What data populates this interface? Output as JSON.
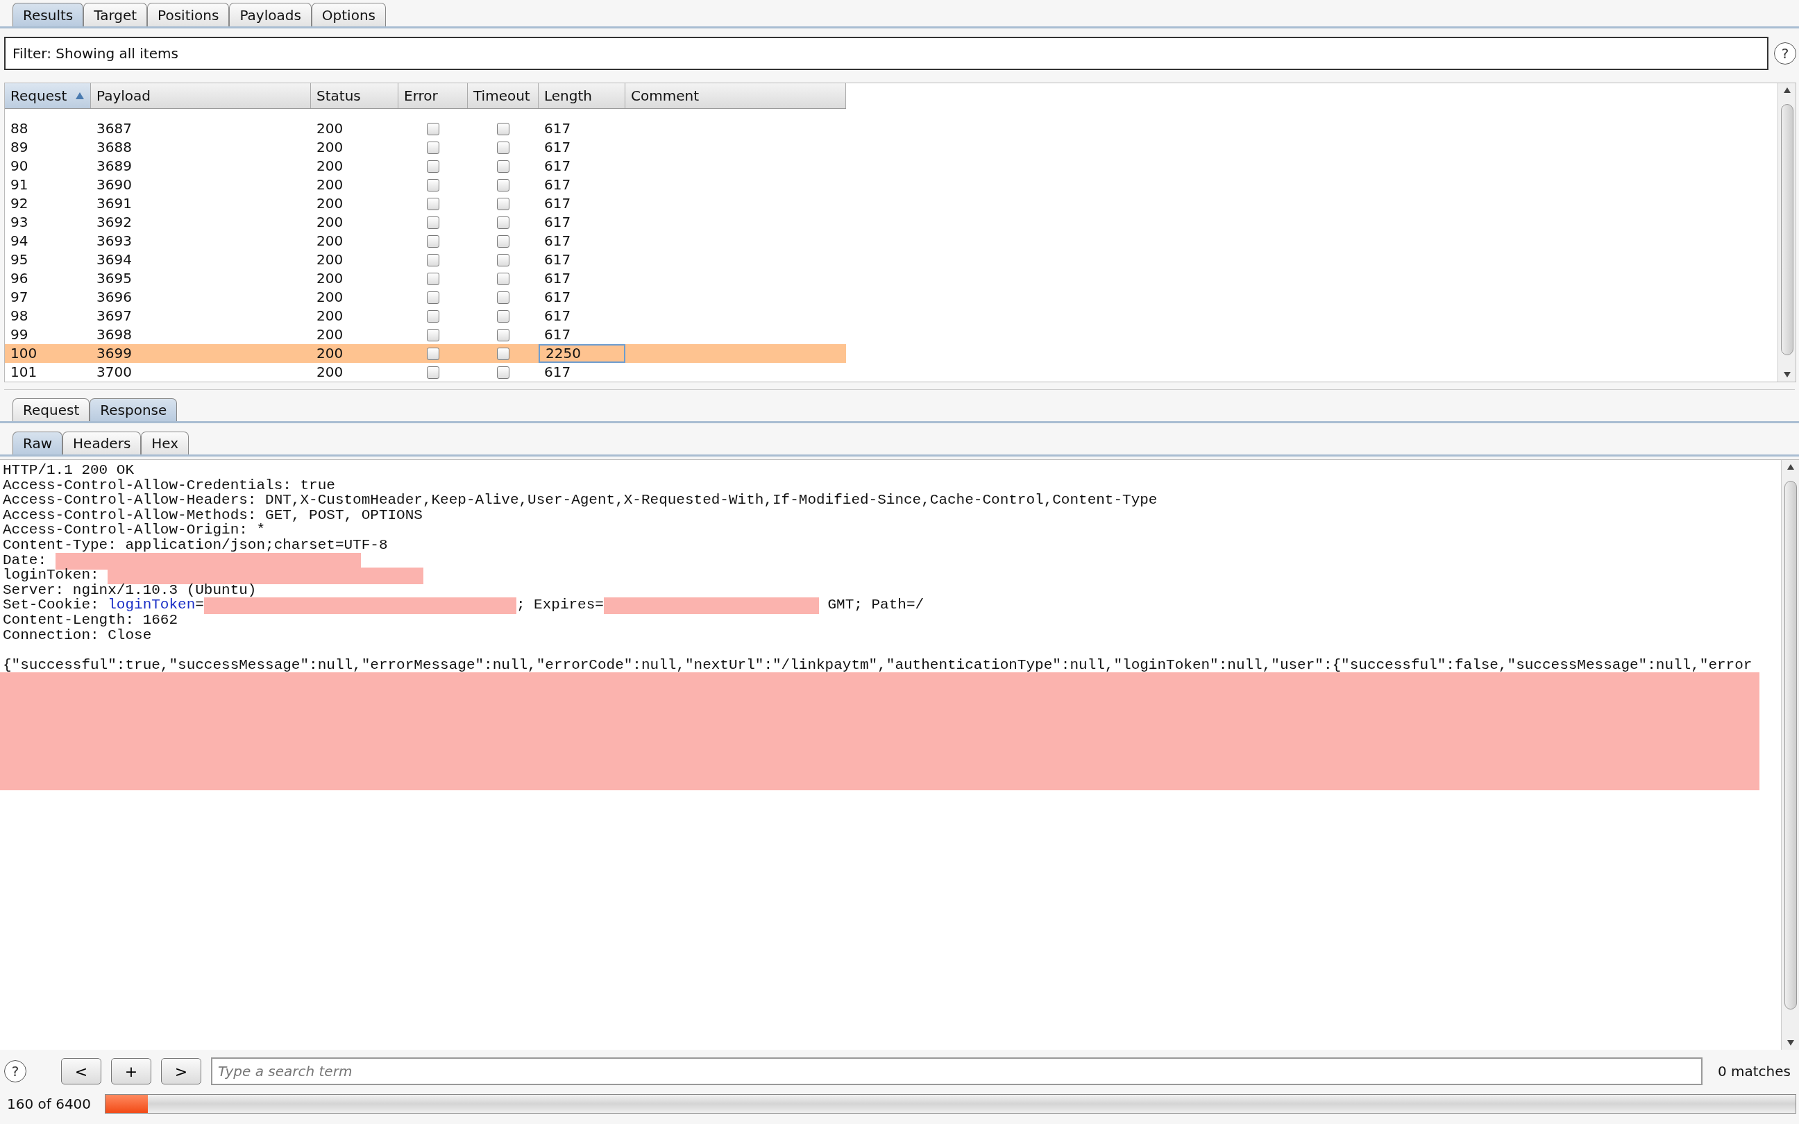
{
  "tabs": [
    {
      "label": "Results",
      "selected": true
    },
    {
      "label": "Target",
      "selected": false
    },
    {
      "label": "Positions",
      "selected": false
    },
    {
      "label": "Payloads",
      "selected": false
    },
    {
      "label": "Options",
      "selected": false
    }
  ],
  "filter": {
    "text": "Filter: Showing all items",
    "help": "?"
  },
  "table": {
    "columns": [
      {
        "label": "Request",
        "sorted": true
      },
      {
        "label": "Payload",
        "sorted": false
      },
      {
        "label": "Status",
        "sorted": false
      },
      {
        "label": "Error",
        "sorted": false
      },
      {
        "label": "Timeout",
        "sorted": false
      },
      {
        "label": "Length",
        "sorted": false
      },
      {
        "label": "Comment",
        "sorted": false
      }
    ],
    "rows": [
      {
        "request": "88",
        "payload": "3687",
        "status": "200",
        "error": false,
        "timeout": false,
        "length": "617",
        "selected": false
      },
      {
        "request": "89",
        "payload": "3688",
        "status": "200",
        "error": false,
        "timeout": false,
        "length": "617",
        "selected": false
      },
      {
        "request": "90",
        "payload": "3689",
        "status": "200",
        "error": false,
        "timeout": false,
        "length": "617",
        "selected": false
      },
      {
        "request": "91",
        "payload": "3690",
        "status": "200",
        "error": false,
        "timeout": false,
        "length": "617",
        "selected": false
      },
      {
        "request": "92",
        "payload": "3691",
        "status": "200",
        "error": false,
        "timeout": false,
        "length": "617",
        "selected": false
      },
      {
        "request": "93",
        "payload": "3692",
        "status": "200",
        "error": false,
        "timeout": false,
        "length": "617",
        "selected": false
      },
      {
        "request": "94",
        "payload": "3693",
        "status": "200",
        "error": false,
        "timeout": false,
        "length": "617",
        "selected": false
      },
      {
        "request": "95",
        "payload": "3694",
        "status": "200",
        "error": false,
        "timeout": false,
        "length": "617",
        "selected": false
      },
      {
        "request": "96",
        "payload": "3695",
        "status": "200",
        "error": false,
        "timeout": false,
        "length": "617",
        "selected": false
      },
      {
        "request": "97",
        "payload": "3696",
        "status": "200",
        "error": false,
        "timeout": false,
        "length": "617",
        "selected": false
      },
      {
        "request": "98",
        "payload": "3697",
        "status": "200",
        "error": false,
        "timeout": false,
        "length": "617",
        "selected": false
      },
      {
        "request": "99",
        "payload": "3698",
        "status": "200",
        "error": false,
        "timeout": false,
        "length": "617",
        "selected": false
      },
      {
        "request": "100",
        "payload": "3699",
        "status": "200",
        "error": false,
        "timeout": false,
        "length": "2250",
        "selected": true
      },
      {
        "request": "101",
        "payload": "3700",
        "status": "200",
        "error": false,
        "timeout": false,
        "length": "617",
        "selected": false
      }
    ]
  },
  "message_tabs": [
    {
      "label": "Request",
      "selected": false
    },
    {
      "label": "Response",
      "selected": true
    }
  ],
  "view_tabs": [
    {
      "label": "Raw",
      "selected": true
    },
    {
      "label": "Headers",
      "selected": false
    },
    {
      "label": "Hex",
      "selected": false
    }
  ],
  "response_lines": [
    {
      "segments": [
        {
          "kind": "text",
          "text": "HTTP/1.1 200 OK"
        }
      ]
    },
    {
      "segments": [
        {
          "kind": "text",
          "text": "Access-Control-Allow-Credentials: true"
        }
      ]
    },
    {
      "segments": [
        {
          "kind": "text",
          "text": "Access-Control-Allow-Headers: DNT,X-CustomHeader,Keep-Alive,User-Agent,X-Requested-With,If-Modified-Since,Cache-Control,Content-Type"
        }
      ]
    },
    {
      "segments": [
        {
          "kind": "text",
          "text": "Access-Control-Allow-Methods: GET, POST, OPTIONS"
        }
      ]
    },
    {
      "segments": [
        {
          "kind": "text",
          "text": "Access-Control-Allow-Origin: *"
        }
      ]
    },
    {
      "segments": [
        {
          "kind": "text",
          "text": "Content-Type: application/json;charset=UTF-8"
        }
      ]
    },
    {
      "segments": [
        {
          "kind": "text",
          "text": "Date: "
        },
        {
          "kind": "redacted"
        }
      ]
    },
    {
      "segments": [
        {
          "kind": "text",
          "text": "loginToken: "
        },
        {
          "kind": "redacted"
        }
      ]
    },
    {
      "segments": [
        {
          "kind": "text",
          "text": "Server: nginx/1.10.3 (Ubuntu)"
        }
      ]
    },
    {
      "segments": [
        {
          "kind": "text",
          "text": "Set-Cookie: "
        },
        {
          "kind": "link",
          "text": "loginToken"
        },
        {
          "kind": "text",
          "text": "="
        },
        {
          "kind": "redacted"
        },
        {
          "kind": "text",
          "text": "; Expires="
        },
        {
          "kind": "redacted"
        },
        {
          "kind": "text",
          "text": " GMT; Path=/"
        }
      ]
    },
    {
      "segments": [
        {
          "kind": "text",
          "text": "Content-Length: 1662"
        }
      ]
    },
    {
      "segments": [
        {
          "kind": "text",
          "text": "Connection: Close"
        }
      ]
    }
  ],
  "response_body": [
    {
      "kind": "text",
      "text": "{\"successful\":true,\"successMessage\":null,\"errorMessage\":null,\"errorCode\":null,\"nextUrl\":\"/linkpaytm\",\"authenticationType\":null,\"loginToken\":null,\"user\":{\"successful\":false,\"successMessage\":null,\"error"
    },
    {
      "kind": "redacted_block"
    }
  ],
  "search": {
    "help": "?",
    "buttons": [
      "<",
      "+",
      ">"
    ],
    "placeholder": "Type a search term",
    "matches": "0 matches"
  },
  "progress": {
    "text": "160 of 6400",
    "level": 0.025
  }
}
